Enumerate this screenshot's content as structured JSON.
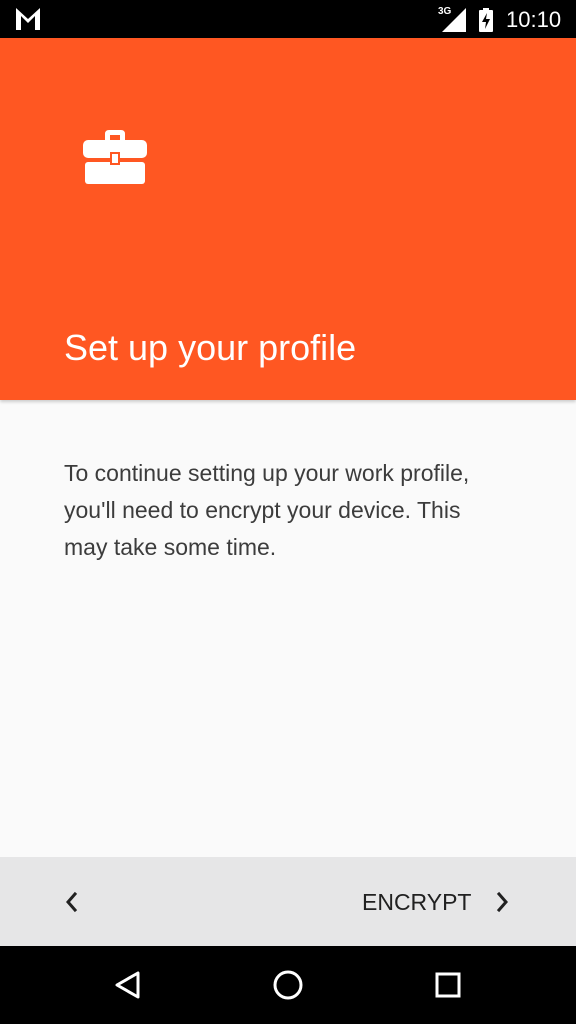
{
  "status_bar": {
    "network_type": "3G",
    "time": "10:10",
    "icons": [
      "gmail-notification-icon",
      "cellular-signal-icon",
      "battery-charging-icon"
    ]
  },
  "header": {
    "icon": "briefcase-icon",
    "title": "Set up your profile",
    "background_color": "#ff5722"
  },
  "content": {
    "message": "To continue setting up your work profile, you'll need to encrypt your device. This may take some time."
  },
  "footer": {
    "back_icon": "chevron-left-icon",
    "next_label": "ENCRYPT",
    "next_icon": "chevron-right-icon"
  },
  "system_nav": {
    "buttons": [
      "back-triangle-icon",
      "home-circle-icon",
      "recents-square-icon"
    ]
  }
}
